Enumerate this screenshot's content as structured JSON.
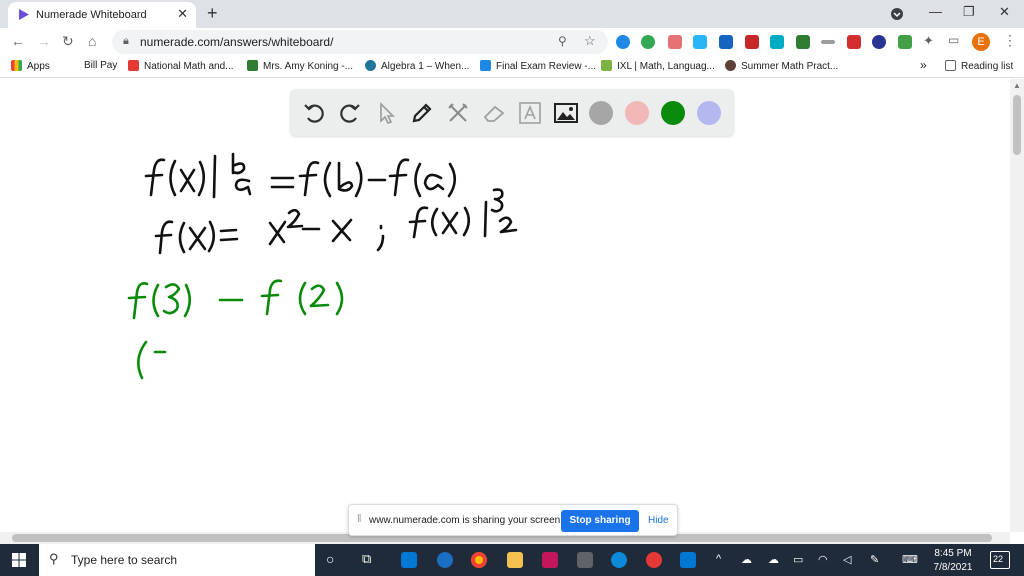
{
  "browser": {
    "tab_title": "Numerade Whiteboard",
    "url": "numerade.com/answers/whiteboard/",
    "profile_initial": "E"
  },
  "bookmarks": {
    "apps": "Apps",
    "items": [
      "Bill Pay",
      "National Math and...",
      "Mrs. Amy Koning -...",
      "Algebra 1 – When...",
      "Final Exam Review -...",
      "IXL | Math, Languag...",
      "Summer Math Pract..."
    ],
    "overflow": "»",
    "reading_list": "Reading list"
  },
  "whiteboard": {
    "tools": [
      "undo-icon",
      "redo-icon",
      "select-icon",
      "pen-icon",
      "tools-icon",
      "eraser-icon",
      "text-icon",
      "image-icon"
    ],
    "colors": [
      "#a6a6a6",
      "#f2b8b8",
      "#0a8a0a",
      "#b4b8ee"
    ]
  },
  "share_banner": {
    "text": "www.numerade.com is sharing your screen.",
    "stop": "Stop sharing",
    "hide": "Hide"
  },
  "taskbar": {
    "search_placeholder": "Type here to search",
    "time": "8:45 PM",
    "date": "7/8/2021",
    "notifications": "22"
  },
  "colors": {
    "ink_black": "#111111",
    "ink_green": "#0a8a0a",
    "accent": "#1a73e8"
  }
}
